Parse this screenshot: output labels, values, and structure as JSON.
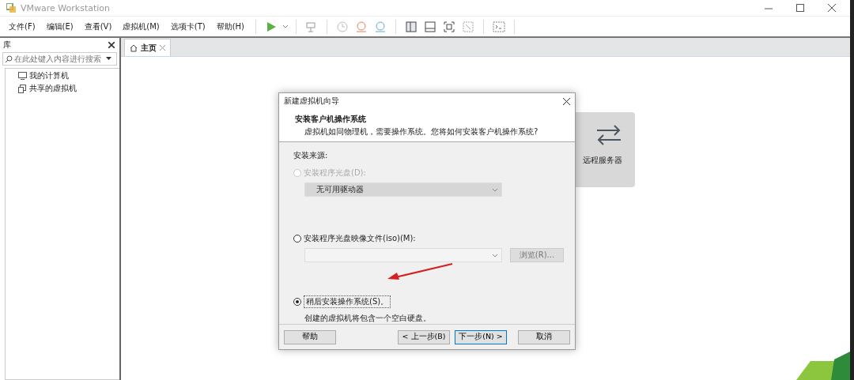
{
  "window": {
    "title": "VMware Workstation"
  },
  "menu": [
    {
      "label": "文件(F)"
    },
    {
      "label": "编辑(E)"
    },
    {
      "label": "查看(V)"
    },
    {
      "label": "虚拟机(M)"
    },
    {
      "label": "选项卡(T)"
    },
    {
      "label": "帮助(H)"
    }
  ],
  "library": {
    "title": "库",
    "search": {
      "placeholder": "在此处键入内容进行搜索"
    },
    "items": [
      {
        "label": "我的计算机",
        "kind": "computer"
      },
      {
        "label": "共享的虚拟机",
        "kind": "shared"
      }
    ]
  },
  "tabs": [
    {
      "label": "主页",
      "selected": true
    }
  ],
  "home": {
    "card": {
      "label": "远程服务器"
    }
  },
  "dialog": {
    "title": "新建虚拟机向导",
    "heading": "安装客户机操作系统",
    "subheading": "虚拟机如同物理机，需要操作系统。您将如何安装客户机操作系统?",
    "source_label": "安装来源:",
    "options": [
      {
        "kind": "drive",
        "label": "安装程序光盘(D):",
        "selected": false,
        "disabled": true,
        "value": "无可用驱动器"
      },
      {
        "kind": "iso",
        "label": "安装程序光盘映像文件(iso)(M):",
        "selected": false,
        "disabled": false,
        "browse": "浏览(R)..."
      },
      {
        "kind": "later",
        "label": "稍后安装操作系统(S)。",
        "selected": true,
        "disabled": false,
        "note": "创建的虚拟机将包含一个空白硬盘。"
      }
    ],
    "buttons": [
      {
        "label": "帮助",
        "kind": "help"
      },
      {
        "label": "< 上一步(B)",
        "kind": "back"
      },
      {
        "label": "下一步(N) >",
        "kind": "next"
      },
      {
        "label": "取消",
        "kind": "cancel"
      }
    ]
  }
}
